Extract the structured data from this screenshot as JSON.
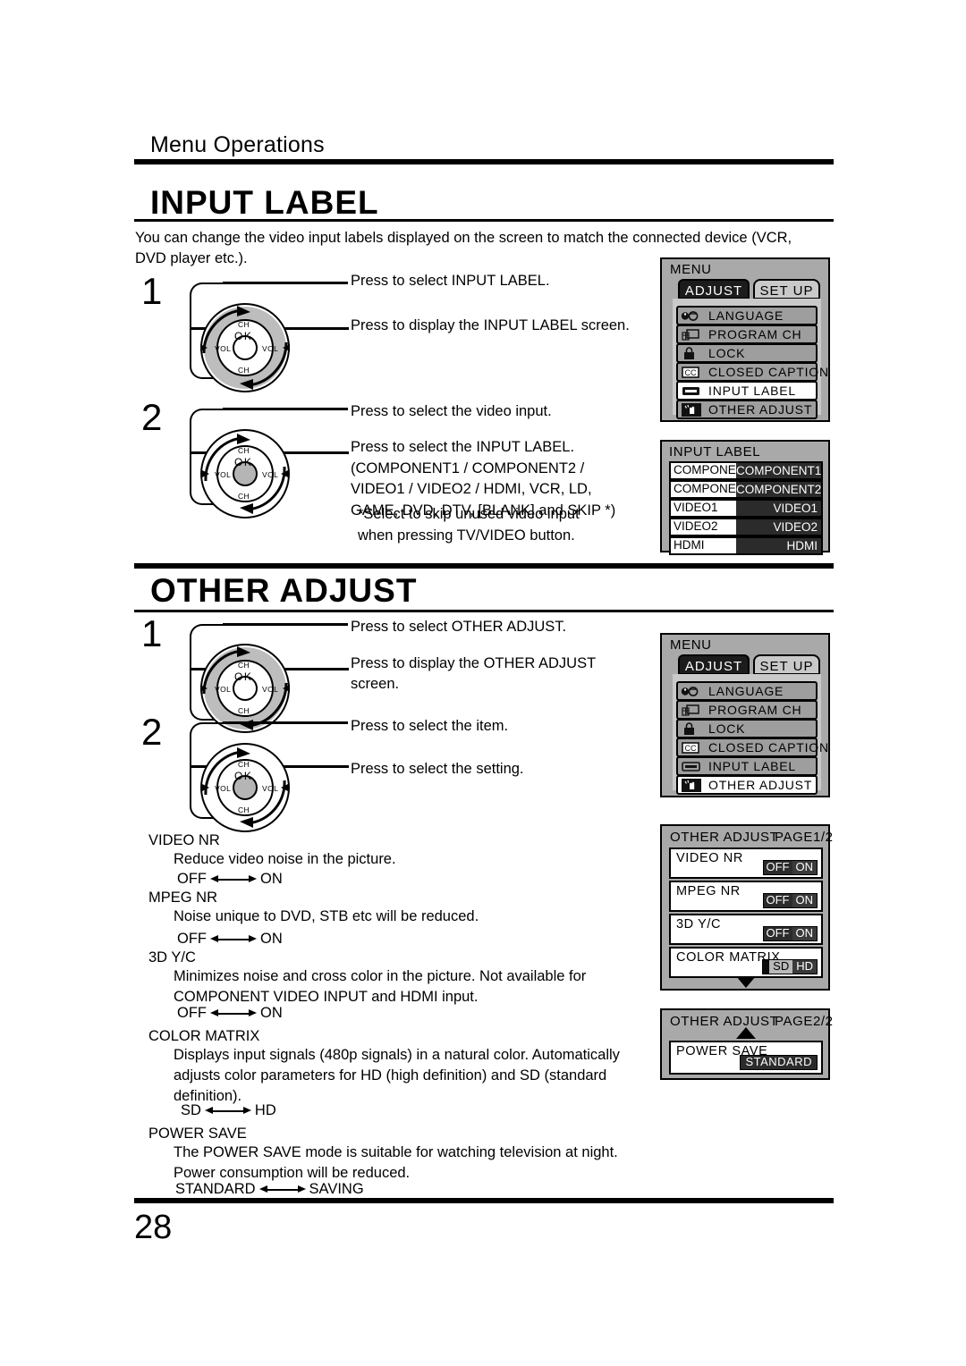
{
  "header": {
    "running_head": "Menu Operations"
  },
  "sections": [
    {
      "title": "INPUT LABEL",
      "intro": "You can change the video input labels displayed on the screen to match the connected device (VCR, DVD player etc.).",
      "steps": [
        {
          "num": "1",
          "line1": "Press to select INPUT LABEL.",
          "line2": "Press to display the INPUT LABEL screen."
        },
        {
          "num": "2",
          "line1": "Press to select the video input.",
          "line2": "Press to select the INPUT LABEL.\n(COMPONENT1 / COMPONENT2 /\nVIDEO1 / VIDEO2 / HDMI, VCR, LD,\nGAME, DVD, DTV, [BLANK] and SKIP *)",
          "footnote": "*Select to skip unused video input\n  when pressing TV/VIDEO button."
        }
      ]
    },
    {
      "title": "OTHER ADJUST",
      "steps": [
        {
          "num": "1",
          "line1": "Press to select OTHER ADJUST.",
          "line2": "Press to display the OTHER ADJUST\nscreen."
        },
        {
          "num": "2",
          "line1": "Press to select the item.",
          "line2": "Press to select the setting."
        }
      ]
    }
  ],
  "settings": [
    {
      "name": "VIDEO NR",
      "desc": "Reduce video noise in the picture.",
      "opt_left": "OFF",
      "opt_right": "ON"
    },
    {
      "name": "MPEG NR",
      "desc": "Noise unique to DVD, STB etc will be reduced.",
      "opt_left": "OFF",
      "opt_right": "ON"
    },
    {
      "name": "3D Y/C",
      "desc": "Minimizes noise and cross color in the picture. Not available for COMPONENT VIDEO INPUT and HDMI input.",
      "opt_left": "OFF",
      "opt_right": "ON"
    },
    {
      "name": "COLOR MATRIX",
      "desc": "Displays input signals (480p signals) in a natural color. Automatically adjusts color parameters for HD (high definition) and SD (standard definition).",
      "opt_left": "SD",
      "opt_right": "HD"
    },
    {
      "name": "POWER SAVE",
      "desc": "The POWER SAVE mode is suitable for watching television at night. Power consumption will be reduced.",
      "opt_left": "STANDARD",
      "opt_right": "SAVING"
    }
  ],
  "osd": {
    "menu": {
      "title": "MENU",
      "tabs": [
        {
          "label": "ADJUST",
          "state": "inactive"
        },
        {
          "label": "SET UP",
          "state": "active"
        }
      ],
      "items": [
        {
          "label": "LANGUAGE",
          "icon": "language-icon"
        },
        {
          "label": "PROGRAM CH",
          "icon": "program-ch-icon"
        },
        {
          "label": "LOCK",
          "icon": "lock-icon"
        },
        {
          "label": "CLOSED CAPTION",
          "icon": "cc-icon"
        },
        {
          "label": "INPUT LABEL",
          "icon": "input-label-icon"
        },
        {
          "label": "OTHER ADJUST",
          "icon": "other-adjust-icon"
        }
      ],
      "selected_first": "INPUT LABEL",
      "selected_second": "OTHER ADJUST"
    },
    "input_label_screen": {
      "title": "INPUT LABEL",
      "rows": [
        {
          "input": "COMPONENT1",
          "value": "COMPONENT1"
        },
        {
          "input": "COMPONENT2",
          "value": "COMPONENT2"
        },
        {
          "input": "VIDEO1",
          "value": "VIDEO1"
        },
        {
          "input": "VIDEO2",
          "value": "VIDEO2"
        },
        {
          "input": "HDMI",
          "value": "HDMI"
        }
      ]
    },
    "other_adjust_p1": {
      "title": "OTHER ADJUST",
      "page": "PAGE1/2",
      "items": [
        {
          "name": "VIDEO NR",
          "type": "onoff",
          "off": "OFF",
          "on": "ON"
        },
        {
          "name": "MPEG NR",
          "type": "onoff",
          "off": "OFF",
          "on": "ON"
        },
        {
          "name": "3D Y/C",
          "type": "onoff",
          "off": "OFF",
          "on": "ON"
        },
        {
          "name": "COLOR MATRIX",
          "type": "sdhd",
          "sd": "SD",
          "hd": "HD"
        }
      ]
    },
    "other_adjust_p2": {
      "title": "OTHER ADJUST",
      "page": "PAGE2/2",
      "items": [
        {
          "name": "POWER SAVE",
          "type": "value",
          "value": "STANDARD"
        }
      ]
    }
  },
  "wheel": {
    "ch": "CH",
    "vol": "VOL",
    "ok": "OK"
  },
  "page_number": "28",
  "colors": {
    "osd_bg": "#a9a9a9",
    "osd_row": "#9e9e9e",
    "dark": "#2b2b2b",
    "selected": "#ffffff"
  }
}
